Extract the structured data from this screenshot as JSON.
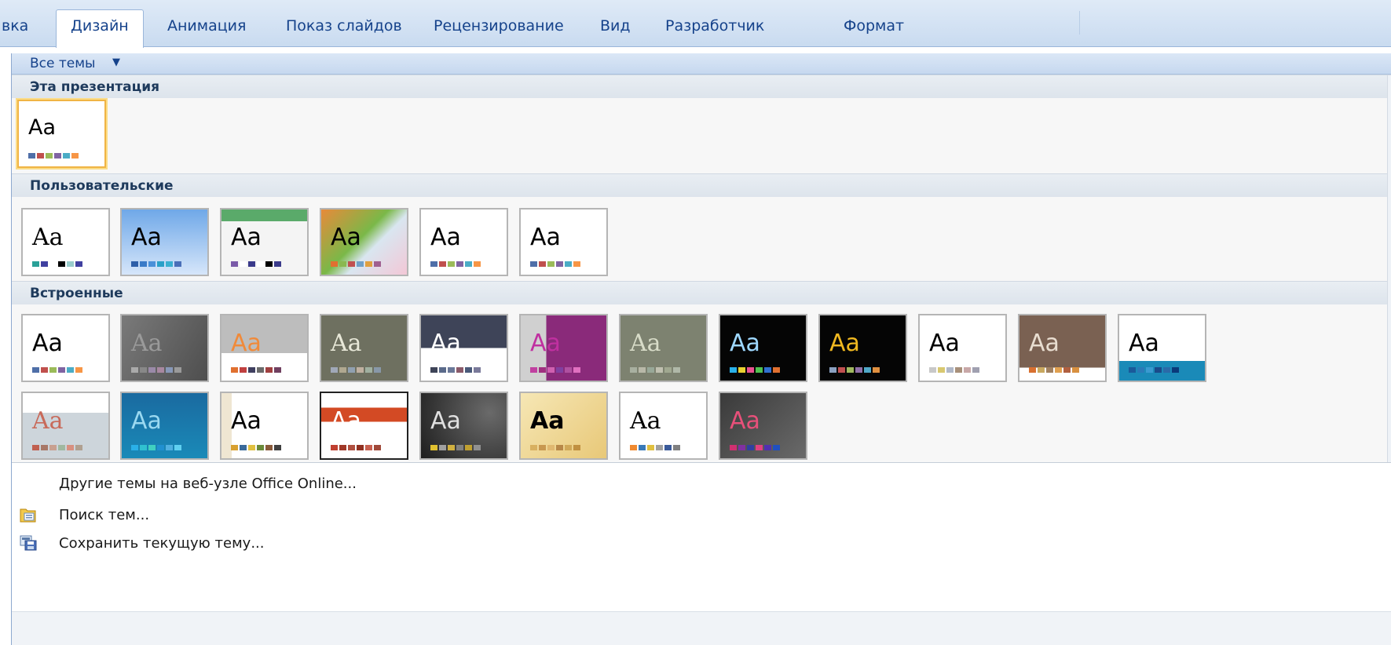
{
  "tabs": [
    {
      "label": "вка"
    },
    {
      "label": "Дизайн",
      "active": true
    },
    {
      "label": "Анимация"
    },
    {
      "label": "Показ слайдов"
    },
    {
      "label": "Рецензирование"
    },
    {
      "label": "Вид"
    },
    {
      "label": "Разработчик"
    },
    {
      "label": "Формат"
    }
  ],
  "gallery": {
    "filter_label": "Все темы",
    "sections": {
      "this_presentation": "Эта презентация",
      "custom": "Пользовательские",
      "builtin": "Встроенные"
    },
    "thumb_text": "Aa"
  },
  "menu": {
    "online": "Другие темы на веб-узле Office Online...",
    "browse": "Поиск тем...",
    "save": "Сохранить текущую тему..."
  },
  "colors": {
    "accent": "#15428b",
    "selection": "#f0b445"
  }
}
